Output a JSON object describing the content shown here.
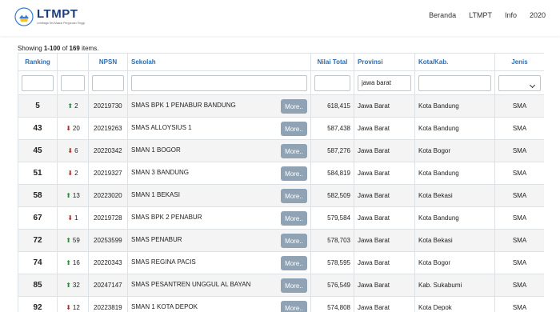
{
  "navbar": {
    "brand_name": "LTMPT",
    "brand_tagline": "Lembaga Tes Masuk Perguruan Tinggi",
    "links": [
      "Beranda",
      "LTMPT",
      "Info",
      "2020"
    ]
  },
  "summary": {
    "prefix": "Showing ",
    "range": "1-100",
    "middle": " of ",
    "total": "169",
    "suffix": " items."
  },
  "columns": {
    "ranking": "Ranking",
    "change": "",
    "npsn": "NPSN",
    "sekolah": "Sekolah",
    "nilai": "Nilai Total",
    "provinsi": "Provinsi",
    "kota": "Kota/Kab.",
    "jenis": "Jenis"
  },
  "filters": {
    "provinsi_value": "jawa barat",
    "jenis_value": ""
  },
  "more_label": "More..",
  "colors": {
    "up": "#2e8b3a",
    "down": "#d01c1c",
    "header_text": "#2a6db3",
    "more_button": "#8fa3b5"
  },
  "rows": [
    {
      "rank": "5",
      "dir": "up",
      "delta": "2",
      "npsn": "20219730",
      "sekolah": "SMAS BPK 1 PENABUR BANDUNG",
      "nilai": "618,415",
      "provinsi": "Jawa Barat",
      "kota": "Kota Bandung",
      "jenis": "SMA"
    },
    {
      "rank": "43",
      "dir": "down",
      "delta": "20",
      "npsn": "20219263",
      "sekolah": "SMAS ALLOYSIUS 1",
      "nilai": "587,438",
      "provinsi": "Jawa Barat",
      "kota": "Kota Bandung",
      "jenis": "SMA"
    },
    {
      "rank": "45",
      "dir": "down",
      "delta": "6",
      "npsn": "20220342",
      "sekolah": "SMAN 1 BOGOR",
      "nilai": "587,276",
      "provinsi": "Jawa Barat",
      "kota": "Kota Bogor",
      "jenis": "SMA"
    },
    {
      "rank": "51",
      "dir": "down",
      "delta": "2",
      "npsn": "20219327",
      "sekolah": "SMAN 3 BANDUNG",
      "nilai": "584,819",
      "provinsi": "Jawa Barat",
      "kota": "Kota Bandung",
      "jenis": "SMA"
    },
    {
      "rank": "58",
      "dir": "up",
      "delta": "13",
      "npsn": "20223020",
      "sekolah": "SMAN 1 BEKASI",
      "nilai": "582,509",
      "provinsi": "Jawa Barat",
      "kota": "Kota Bekasi",
      "jenis": "SMA"
    },
    {
      "rank": "67",
      "dir": "down",
      "delta": "1",
      "npsn": "20219728",
      "sekolah": "SMAS BPK 2 PENABUR",
      "nilai": "579,584",
      "provinsi": "Jawa Barat",
      "kota": "Kota Bandung",
      "jenis": "SMA"
    },
    {
      "rank": "72",
      "dir": "up",
      "delta": "59",
      "npsn": "20253599",
      "sekolah": "SMAS PENABUR",
      "nilai": "578,703",
      "provinsi": "Jawa Barat",
      "kota": "Kota Bekasi",
      "jenis": "SMA"
    },
    {
      "rank": "74",
      "dir": "up",
      "delta": "16",
      "npsn": "20220343",
      "sekolah": "SMAS REGINA PACIS",
      "nilai": "578,595",
      "provinsi": "Jawa Barat",
      "kota": "Kota Bogor",
      "jenis": "SMA"
    },
    {
      "rank": "85",
      "dir": "up",
      "delta": "32",
      "npsn": "20247147",
      "sekolah": "SMAS PESANTREN UNGGUL AL BAYAN",
      "nilai": "576,549",
      "provinsi": "Jawa Barat",
      "kota": "Kab. Sukabumi",
      "jenis": "SMA"
    },
    {
      "rank": "92",
      "dir": "down",
      "delta": "12",
      "npsn": "20223819",
      "sekolah": "SMAN 1 KOTA DEPOK",
      "nilai": "574,808",
      "provinsi": "Jawa Barat",
      "kota": "Kota Depok",
      "jenis": "SMA"
    }
  ]
}
